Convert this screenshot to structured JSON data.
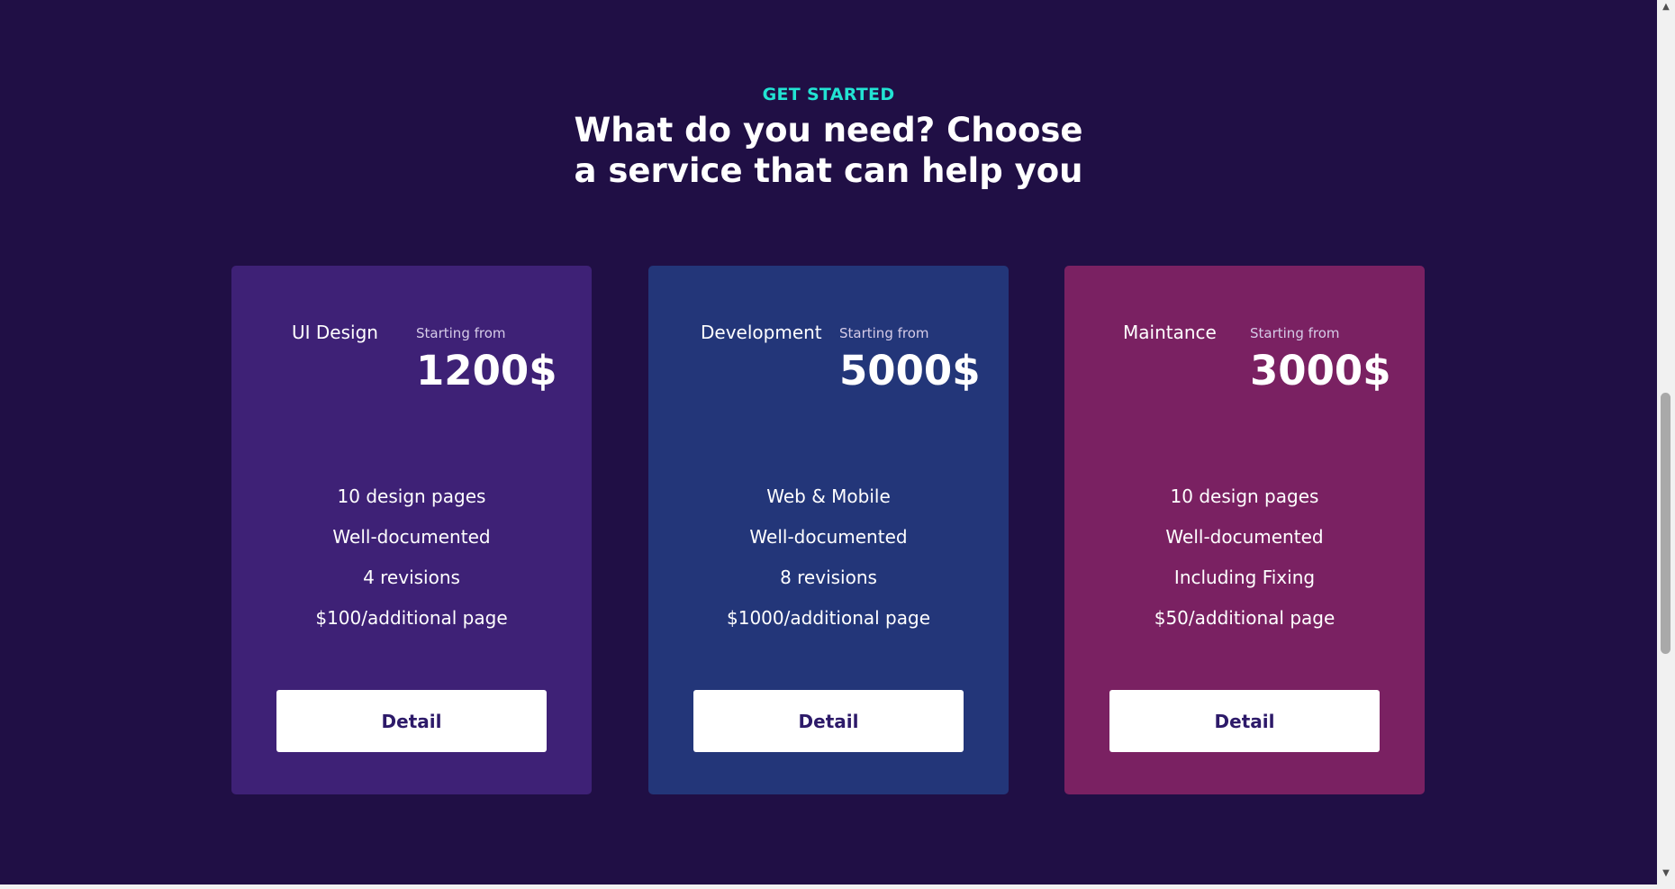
{
  "section": {
    "eyebrow": "GET STARTED",
    "headline": "What do you need? Choose a service that can help you"
  },
  "cards": [
    {
      "name": "UI Design",
      "starting_from": "Starting from",
      "price": "1200$",
      "features": [
        "10 design pages",
        "Well-documented",
        "4 revisions",
        "$100/additional page"
      ],
      "button_label": "Detail",
      "color": "#3e2176"
    },
    {
      "name": "Development",
      "starting_from": "Starting from",
      "price": "5000$",
      "features": [
        "Web & Mobile",
        "Well-documented",
        "8 revisions",
        "$1000/additional page"
      ],
      "button_label": "Detail",
      "color": "#233679"
    },
    {
      "name": "Maintance",
      "starting_from": "Starting from",
      "price": "3000$",
      "features": [
        "10 design pages",
        "Well-documented",
        "Including Fixing",
        "$50/additional page"
      ],
      "button_label": "Detail",
      "color": "#7a2162"
    }
  ],
  "colors": {
    "background": "#200f45",
    "accent": "#22e3d3",
    "button_text": "#2d1a69"
  },
  "scrollbar": {
    "up_icon": "arrow-up-icon",
    "down_icon": "arrow-down-icon"
  }
}
